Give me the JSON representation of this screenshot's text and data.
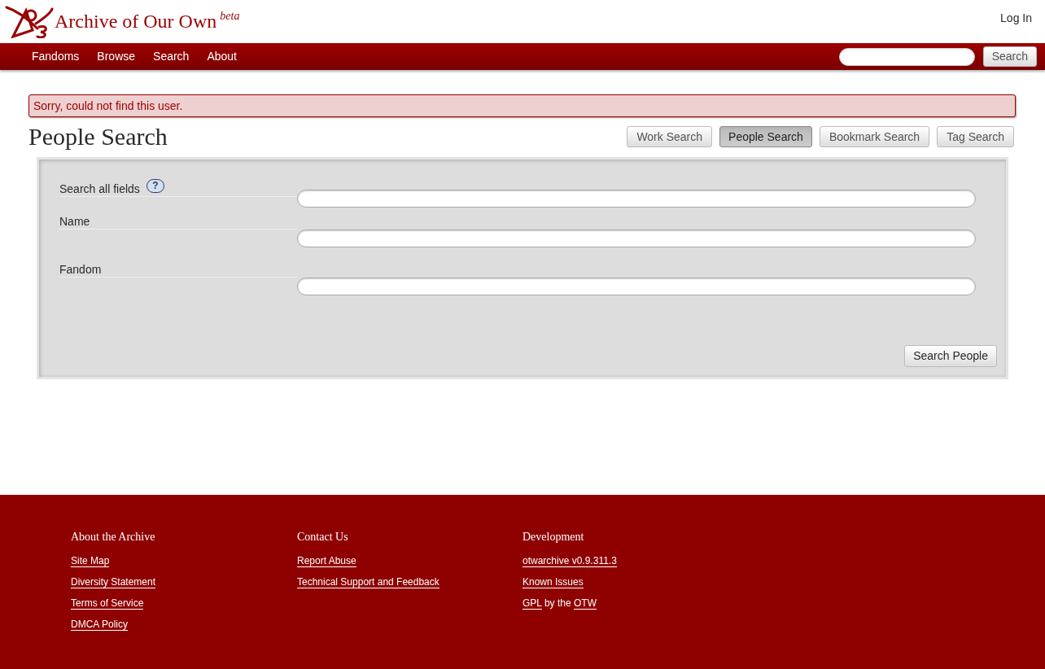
{
  "header": {
    "site_title": "Archive of Our Own",
    "badge": "beta",
    "login": "Log In"
  },
  "nav": {
    "items": [
      "Fandoms",
      "Browse",
      "Search",
      "About"
    ],
    "search_button": "Search"
  },
  "flash_error": "Sorry, could not find this user.",
  "page_title": "People Search",
  "tabs": [
    {
      "label": "Work Search",
      "selected": false
    },
    {
      "label": "People Search",
      "selected": true
    },
    {
      "label": "Bookmark Search",
      "selected": false
    },
    {
      "label": "Tag Search",
      "selected": false
    }
  ],
  "form": {
    "fields": [
      {
        "label": "Search all fields",
        "help": "?"
      },
      {
        "label": "Name"
      },
      {
        "label": "Fandom"
      }
    ],
    "submit": "Search People"
  },
  "footer": {
    "columns": [
      {
        "heading": "About the Archive",
        "lines": [
          [
            {
              "text": "Site Map",
              "link": true
            }
          ],
          [
            {
              "text": "Diversity Statement",
              "link": true
            }
          ],
          [
            {
              "text": "Terms of Service",
              "link": true
            }
          ],
          [
            {
              "text": "DMCA Policy",
              "link": true
            }
          ]
        ]
      },
      {
        "heading": "Contact Us",
        "lines": [
          [
            {
              "text": "Report Abuse",
              "link": true
            }
          ],
          [
            {
              "text": "Technical Support and Feedback",
              "link": true
            }
          ]
        ]
      },
      {
        "heading": "Development",
        "lines": [
          [
            {
              "text": "otwarchive v0.9.311.3",
              "link": true
            }
          ],
          [
            {
              "text": "Known Issues",
              "link": true
            }
          ],
          [
            {
              "text": "GPL",
              "link": true
            },
            {
              "text": "by the",
              "link": false
            },
            {
              "text": "OTW",
              "link": true
            }
          ]
        ]
      }
    ]
  }
}
